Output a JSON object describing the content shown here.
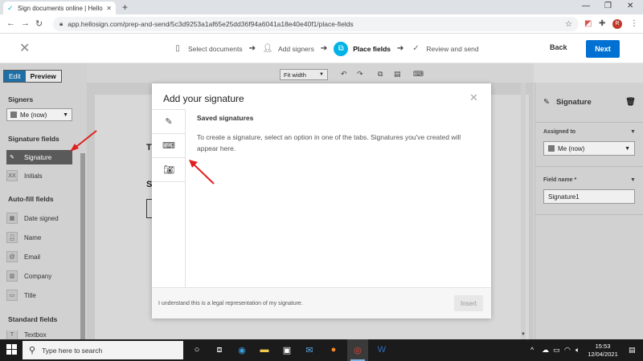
{
  "browser": {
    "tab_title": "Sign documents online | HelloSign",
    "url": "app.hellosign.com/prep-and-send/5c3d9253a1af65e25dd36f94a6041a18e40e40f1/place-fields",
    "profile_initial": "R"
  },
  "header": {
    "steps": [
      {
        "label": "Select documents"
      },
      {
        "label": "Add signers"
      },
      {
        "label": "Place fields"
      },
      {
        "label": "Review and send"
      }
    ],
    "back_label": "Back",
    "next_label": "Next"
  },
  "sidebar": {
    "edit_label": "Edit",
    "preview_label": "Preview",
    "signers_heading": "Signers",
    "signer_selected": "Me (now)",
    "signature_fields_heading": "Signature fields",
    "signature_label": "Signature",
    "initials_label": "Initials",
    "initials_icon": "XX",
    "autofill_heading": "Auto-fill fields",
    "autofill_items": [
      "Date signed",
      "Name",
      "Email",
      "Company",
      "Title"
    ],
    "standard_heading": "Standard fields",
    "standard_first": "Textbox"
  },
  "doc": {
    "zoom": "Fit width",
    "letter_t": "T",
    "letter_s": "S"
  },
  "right_panel": {
    "title": "Signature",
    "assigned_label": "Assigned to",
    "assigned_value": "Me (now)",
    "field_name_label": "Field name *",
    "field_name_value": "Signature1"
  },
  "modal": {
    "title": "Add your signature",
    "heading": "Saved signatures",
    "description": "To create a signature, select an option in one of the tabs. Signatures you've created will appear here.",
    "legal": "I understand this is a legal representation of my signature.",
    "insert_label": "Insert"
  },
  "taskbar": {
    "search_placeholder": "Type here to search",
    "time": "15:53",
    "date": "12/04/2021"
  },
  "colors": {
    "accent": "#00b3e6",
    "next_button": "#0070d2",
    "annotation": "#e02020"
  }
}
